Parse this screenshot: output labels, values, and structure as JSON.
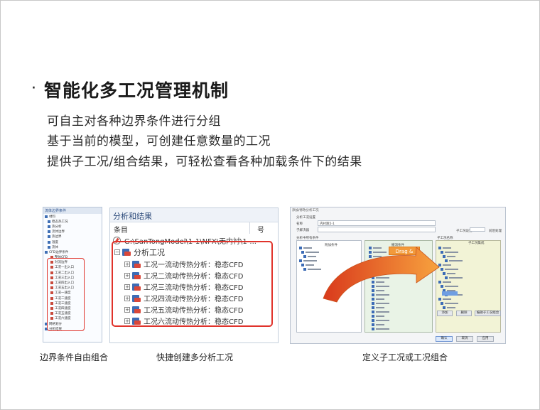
{
  "bullet": "·",
  "heading": "智能化多工况管理机制",
  "lines": [
    "可自主对各种边界条件进行分组",
    "基于当前的模型，可创建任意数量的工况",
    "提供子工况/组合结果，可轻松查看各种加载条件下的结果"
  ],
  "shot1": {
    "header": "流体边界条件",
    "rows": [
      "材料",
      "稳态热工况",
      "热分析",
      "流体边界",
      "热边界",
      "温度",
      "流体",
      "CFD边界条件",
      "整体CFD",
      "对流边界",
      "工况一出入口",
      "工况二出入口",
      "工况三出入口",
      "工况四出入口",
      "工况五出入口",
      "工况一速度",
      "工况二速度",
      "工况三速度",
      "工况四速度",
      "工况五速度",
      "工况六速度",
      "网格划分",
      "分析结果"
    ]
  },
  "shot2": {
    "title": "分析和结果",
    "col_item": "条目",
    "col_num": "号",
    "path": "G:\\SanTongModel\\1-1\\NFX\\无内衬\\1-...",
    "root_label": "分析工况",
    "expander_plus": "+",
    "expander_minus": "−",
    "cases": [
      "工况一流动传热分析：稳态CFD",
      "工况二流动传热分析：稳态CFD",
      "工况三流动传热分析：稳态CFD",
      "工况四流动传热分析：稳态CFD",
      "工况五流动传热分析：稳态CFD",
      "工况六流动传热分析：稳态CFD"
    ]
  },
  "shot3": {
    "title": "添加/修改分析工况",
    "section": "分析工况设置",
    "name_label": "名称",
    "name_value": "内衬跌5-1",
    "sub_label": "子解决器",
    "left_label": "分析中所有条件",
    "mid_label": "附加条件",
    "mid2_label": "撤消条件",
    "right_label": "子工况设置",
    "right2_label": "前后处理",
    "right_sub": "子工况名称",
    "right_check": "子工况集成",
    "drag_drop": "Drag & Drop",
    "ok": "确认",
    "cancel": "取消",
    "apply": "应用",
    "add": "添加",
    "delete": "删除",
    "edit": "编辑子工况组合"
  },
  "captions": [
    "边界条件自由组合",
    "快捷创建多分析工况",
    "定义子工况或工况组合"
  ],
  "colors": {
    "accent_red": "#e0332b",
    "arrow_orange": "#f0651d",
    "drag_orange": "#f29a3b"
  }
}
